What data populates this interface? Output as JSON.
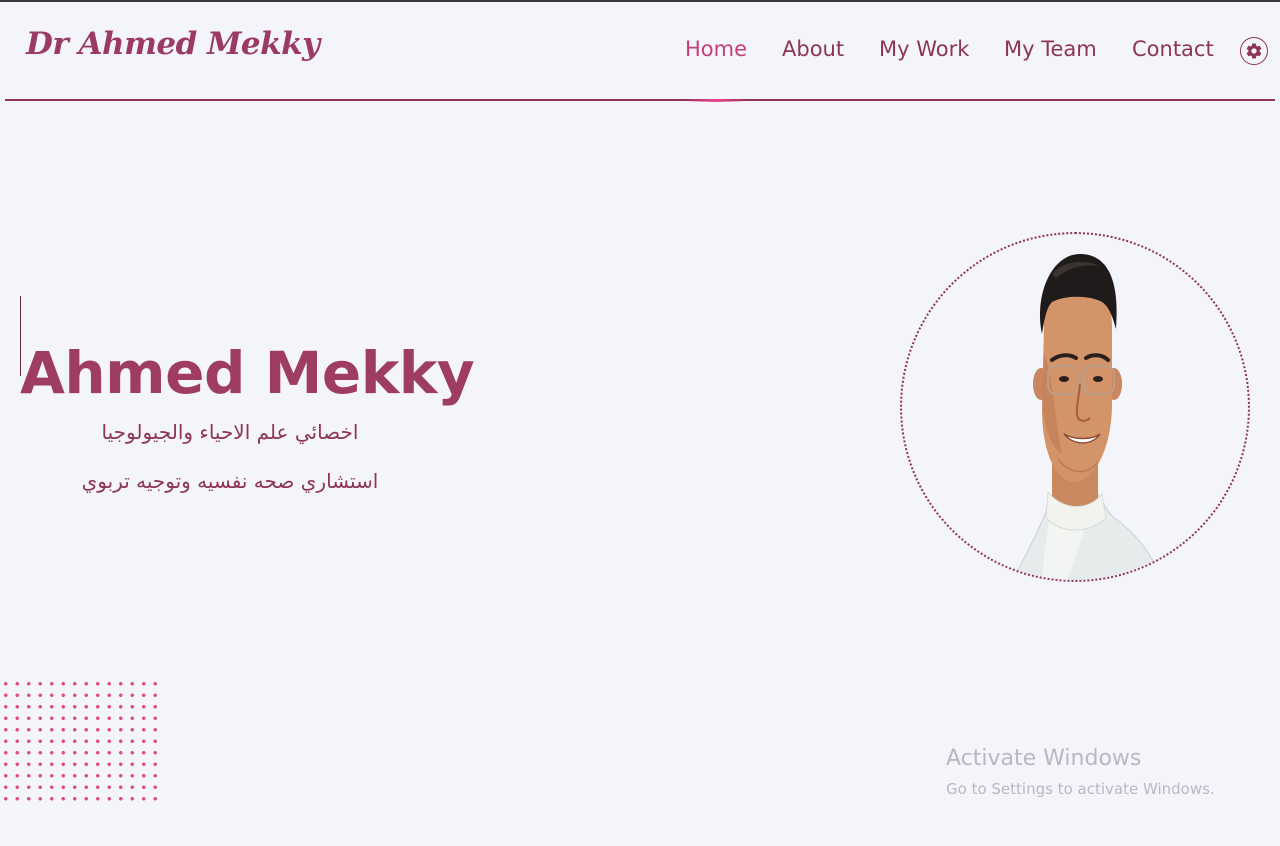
{
  "brand": {
    "logo_text": "Dr Ahmed Mekky",
    "accent": "#9c3a66",
    "active_color": "#c73f78",
    "background": "#f4f4fb"
  },
  "nav": {
    "items": [
      {
        "label": "Home",
        "active": true
      },
      {
        "label": "About"
      },
      {
        "label": "My Work"
      },
      {
        "label": "My Team"
      },
      {
        "label": "Contact"
      }
    ],
    "settings_icon": "gear-icon"
  },
  "hero": {
    "name": "Ahmed Mekky",
    "line1": "اخصائي علم الاحياء والجيولوجيا",
    "line2": "استشاري صحه نفسيه وتوجيه تربوي",
    "portrait_icon": "profile-portrait"
  },
  "watermark": {
    "title": "Activate Windows",
    "subtitle": "Go to Settings to activate Windows."
  }
}
